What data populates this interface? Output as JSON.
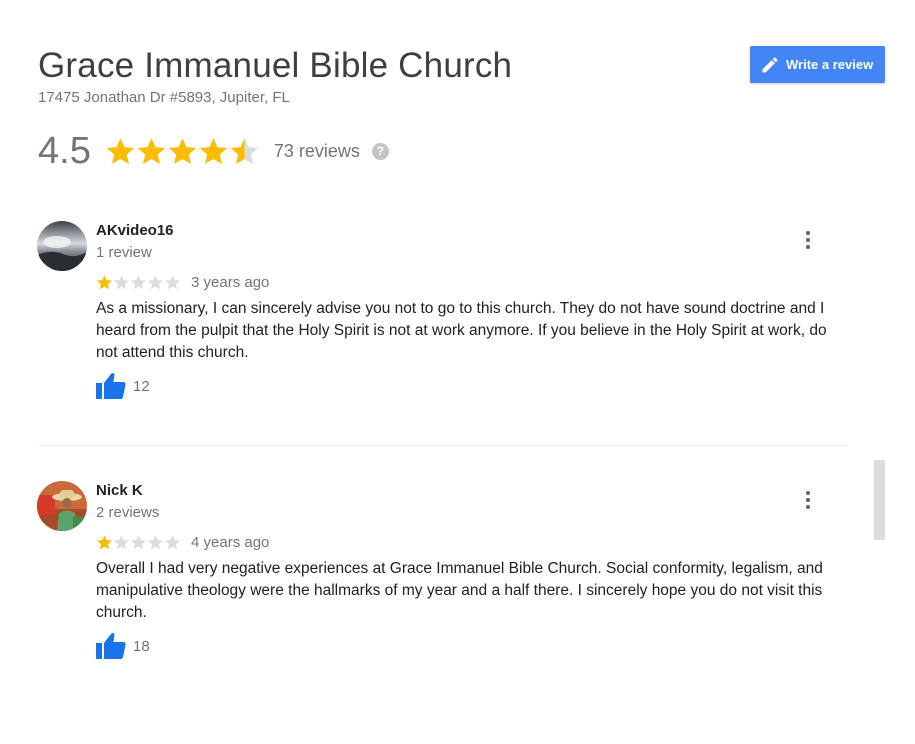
{
  "place": {
    "name": "Grace Immanuel Bible Church",
    "address": "17475 Jonathan Dr #5893, Jupiter, FL"
  },
  "write_review": {
    "label": "Write a review",
    "icon": "pencil-icon"
  },
  "summary": {
    "rating": "4.5",
    "rating_value": 4.5,
    "max_stars": 5,
    "reviews_label": "73 reviews",
    "help_icon": "?"
  },
  "colors": {
    "star_filled": "#fbbc04",
    "star_empty": "#dadce0",
    "thumb": "#1a73e8",
    "button": "#4285f4"
  },
  "reviews": [
    {
      "author": "AKvideo16",
      "review_count": "1 review",
      "rating": 1,
      "date": "3 years ago",
      "text": "As a missionary, I can sincerely advise you not to go to this church. They do not have sound doctrine and I heard from the pulpit that the Holy Spirit is not at work anymore. If you believe in the Holy Spirit at work, do not attend this church.",
      "likes": "12"
    },
    {
      "author": "Nick K",
      "review_count": "2 reviews",
      "rating": 1,
      "date": "4 years ago",
      "text": "Overall I had very negative experiences at Grace Immanuel Bible Church. Social conformity, legalism, and manipulative theology were the hallmarks of my year and a half there. I sincerely hope you do not visit this church.",
      "likes": "18"
    }
  ]
}
